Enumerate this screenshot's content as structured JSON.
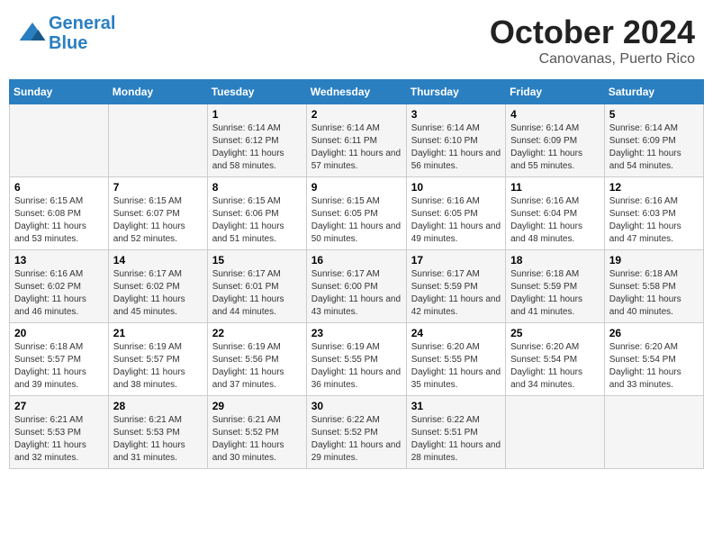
{
  "header": {
    "logo_line1": "General",
    "logo_line2": "Blue",
    "month": "October 2024",
    "location": "Canovanas, Puerto Rico"
  },
  "days_of_week": [
    "Sunday",
    "Monday",
    "Tuesday",
    "Wednesday",
    "Thursday",
    "Friday",
    "Saturday"
  ],
  "weeks": [
    [
      {
        "day": "",
        "info": ""
      },
      {
        "day": "",
        "info": ""
      },
      {
        "day": "1",
        "sunrise": "6:14 AM",
        "sunset": "6:12 PM",
        "daylight": "11 hours and 58 minutes."
      },
      {
        "day": "2",
        "sunrise": "6:14 AM",
        "sunset": "6:11 PM",
        "daylight": "11 hours and 57 minutes."
      },
      {
        "day": "3",
        "sunrise": "6:14 AM",
        "sunset": "6:10 PM",
        "daylight": "11 hours and 56 minutes."
      },
      {
        "day": "4",
        "sunrise": "6:14 AM",
        "sunset": "6:09 PM",
        "daylight": "11 hours and 55 minutes."
      },
      {
        "day": "5",
        "sunrise": "6:14 AM",
        "sunset": "6:09 PM",
        "daylight": "11 hours and 54 minutes."
      }
    ],
    [
      {
        "day": "6",
        "sunrise": "6:15 AM",
        "sunset": "6:08 PM",
        "daylight": "11 hours and 53 minutes."
      },
      {
        "day": "7",
        "sunrise": "6:15 AM",
        "sunset": "6:07 PM",
        "daylight": "11 hours and 52 minutes."
      },
      {
        "day": "8",
        "sunrise": "6:15 AM",
        "sunset": "6:06 PM",
        "daylight": "11 hours and 51 minutes."
      },
      {
        "day": "9",
        "sunrise": "6:15 AM",
        "sunset": "6:05 PM",
        "daylight": "11 hours and 50 minutes."
      },
      {
        "day": "10",
        "sunrise": "6:16 AM",
        "sunset": "6:05 PM",
        "daylight": "11 hours and 49 minutes."
      },
      {
        "day": "11",
        "sunrise": "6:16 AM",
        "sunset": "6:04 PM",
        "daylight": "11 hours and 48 minutes."
      },
      {
        "day": "12",
        "sunrise": "6:16 AM",
        "sunset": "6:03 PM",
        "daylight": "11 hours and 47 minutes."
      }
    ],
    [
      {
        "day": "13",
        "sunrise": "6:16 AM",
        "sunset": "6:02 PM",
        "daylight": "11 hours and 46 minutes."
      },
      {
        "day": "14",
        "sunrise": "6:17 AM",
        "sunset": "6:02 PM",
        "daylight": "11 hours and 45 minutes."
      },
      {
        "day": "15",
        "sunrise": "6:17 AM",
        "sunset": "6:01 PM",
        "daylight": "11 hours and 44 minutes."
      },
      {
        "day": "16",
        "sunrise": "6:17 AM",
        "sunset": "6:00 PM",
        "daylight": "11 hours and 43 minutes."
      },
      {
        "day": "17",
        "sunrise": "6:17 AM",
        "sunset": "5:59 PM",
        "daylight": "11 hours and 42 minutes."
      },
      {
        "day": "18",
        "sunrise": "6:18 AM",
        "sunset": "5:59 PM",
        "daylight": "11 hours and 41 minutes."
      },
      {
        "day": "19",
        "sunrise": "6:18 AM",
        "sunset": "5:58 PM",
        "daylight": "11 hours and 40 minutes."
      }
    ],
    [
      {
        "day": "20",
        "sunrise": "6:18 AM",
        "sunset": "5:57 PM",
        "daylight": "11 hours and 39 minutes."
      },
      {
        "day": "21",
        "sunrise": "6:19 AM",
        "sunset": "5:57 PM",
        "daylight": "11 hours and 38 minutes."
      },
      {
        "day": "22",
        "sunrise": "6:19 AM",
        "sunset": "5:56 PM",
        "daylight": "11 hours and 37 minutes."
      },
      {
        "day": "23",
        "sunrise": "6:19 AM",
        "sunset": "5:55 PM",
        "daylight": "11 hours and 36 minutes."
      },
      {
        "day": "24",
        "sunrise": "6:20 AM",
        "sunset": "5:55 PM",
        "daylight": "11 hours and 35 minutes."
      },
      {
        "day": "25",
        "sunrise": "6:20 AM",
        "sunset": "5:54 PM",
        "daylight": "11 hours and 34 minutes."
      },
      {
        "day": "26",
        "sunrise": "6:20 AM",
        "sunset": "5:54 PM",
        "daylight": "11 hours and 33 minutes."
      }
    ],
    [
      {
        "day": "27",
        "sunrise": "6:21 AM",
        "sunset": "5:53 PM",
        "daylight": "11 hours and 32 minutes."
      },
      {
        "day": "28",
        "sunrise": "6:21 AM",
        "sunset": "5:53 PM",
        "daylight": "11 hours and 31 minutes."
      },
      {
        "day": "29",
        "sunrise": "6:21 AM",
        "sunset": "5:52 PM",
        "daylight": "11 hours and 30 minutes."
      },
      {
        "day": "30",
        "sunrise": "6:22 AM",
        "sunset": "5:52 PM",
        "daylight": "11 hours and 29 minutes."
      },
      {
        "day": "31",
        "sunrise": "6:22 AM",
        "sunset": "5:51 PM",
        "daylight": "11 hours and 28 minutes."
      },
      {
        "day": "",
        "info": ""
      },
      {
        "day": "",
        "info": ""
      }
    ]
  ]
}
